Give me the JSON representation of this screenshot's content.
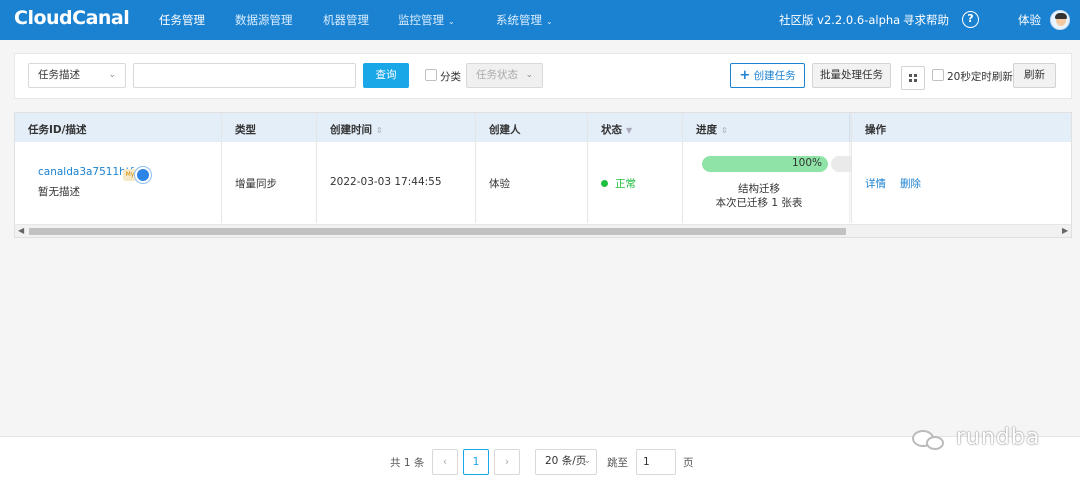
{
  "header": {
    "logo": "CloudCanal",
    "nav": [
      {
        "label": "任务管理",
        "active": true
      },
      {
        "label": "数据源管理"
      },
      {
        "label": "机器管理"
      },
      {
        "label": "监控管理",
        "caret": "⌄"
      },
      {
        "label": "系统管理",
        "caret": "⌄"
      }
    ],
    "edition": "社区版 v2.2.0.6-alpha",
    "help": "寻求帮助",
    "help_icon": "?",
    "user": "体验",
    "colors": {
      "bar": "#1b82d2"
    }
  },
  "filter": {
    "search_field": "任务描述",
    "search_value": "",
    "query_button": "查询",
    "category_label": "分类",
    "status_placeholder": "任务状态",
    "create_button": "创建任务",
    "batch_button": "批量处理任务",
    "auto_refresh_label": "20秒定时刷新",
    "refresh_button": "刷新"
  },
  "table": {
    "columns": [
      "任务ID/描述",
      "类型",
      "创建时间",
      "创建人",
      "状态",
      "进度",
      "操作"
    ],
    "rows": [
      {
        "task_id": "canalda3a7511htf",
        "description": "暂无描述",
        "type": "增量同步",
        "created_at": "2022-03-03 17:44:55",
        "creator": "体验",
        "status": "正常",
        "progress_pct": 100,
        "progress_label": "100%",
        "stage": "结构迁移",
        "stage_detail": "本次已迁移 1 张表",
        "actions": [
          "详情",
          "删除"
        ]
      }
    ]
  },
  "pagination": {
    "total": "共 1 条",
    "prev": "‹",
    "current": "1",
    "next": "›",
    "page_size": "20 条/页",
    "jump_label": "跳至",
    "jump_value": "1",
    "page_unit": "页"
  },
  "watermark": "rundba"
}
